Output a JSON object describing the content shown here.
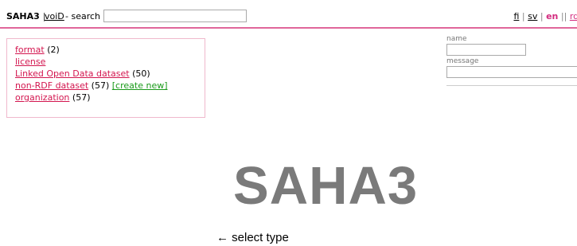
{
  "header": {
    "brand": "SAHA3",
    "separator": "|",
    "void_link": "voiD",
    "search_label": "- search",
    "search_value": ""
  },
  "languages": {
    "fi": "fi",
    "sv": "sv",
    "en": "en",
    "rdf": "rdf",
    "active": "en"
  },
  "types": [
    {
      "label": "format",
      "count": "(2)",
      "create": ""
    },
    {
      "label": "license",
      "count": "",
      "create": ""
    },
    {
      "label": "Linked Open Data dataset",
      "count": "(50)",
      "create": ""
    },
    {
      "label": "non-RDF dataset",
      "count": "(57)",
      "create": "[create new]"
    },
    {
      "label": "organization",
      "count": "(57)",
      "create": ""
    }
  ],
  "chat": {
    "name_label": "name",
    "message_label": "message",
    "name_value": "",
    "message_value": ""
  },
  "logo": "SAHA3",
  "hint": "← select type",
  "colors": {
    "accent": "#e0669a",
    "link": "#d3164f",
    "create_link": "#1a9a1a",
    "logo": "#7a7a7a"
  }
}
